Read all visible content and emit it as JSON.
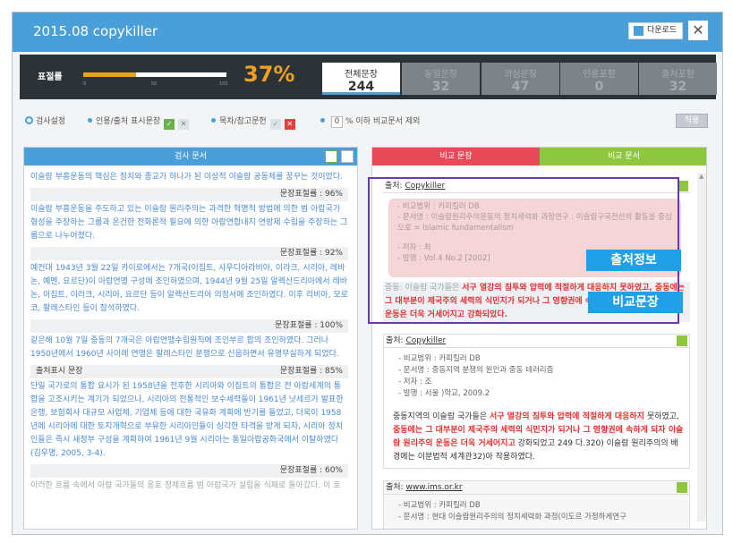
{
  "window": {
    "title": "2015.08 copykiller",
    "download_label": "다운로드",
    "close_symbol": "✕"
  },
  "stats": {
    "plagiarism_label": "표절률",
    "progress_fraction": 0.37,
    "ticks": [
      "0",
      "50",
      "100"
    ],
    "percent": "37%",
    "tabs": [
      {
        "label": "전체문장",
        "value": "244"
      },
      {
        "label": "동일문장",
        "value": "32"
      },
      {
        "label": "의심문장",
        "value": "47"
      },
      {
        "label": "인용포함",
        "value": "0"
      },
      {
        "label": "출처포함",
        "value": "32"
      }
    ]
  },
  "options": {
    "settings": "검사설정",
    "quote": "인용/출처 표시문장",
    "toc": "목차/참고문헌",
    "threshold": "0",
    "threshold_suffix": "% 이하 비교문서 제외",
    "apply": "적용"
  },
  "left": {
    "header": "검사 문서",
    "p1": "이슬람 부흥운동의 핵심은 정치와 종교가 하나가 된 이상적 이슬람 공동체를 꿈꾸는 것이었다.",
    "sim1": "문장표절률 : 96%",
    "p2": "이슬람 부흥운동을 주도하고 있는 이슬람 원리주의는 과격한 혁명적 방법에 의한 범 아랍국가 형성을 주장하는 그룹과 온건한 전화론적 필요에 의한 아랍연합내지 연방제 수립을 주장하는 그룹으로 나누어졌다.",
    "sim2": "문장표절률 : 92%",
    "p3": "예컨대 1943년 3월 22일 카이로에서는 7개국(이집트, 사우디아라비아, 이라크, 시리아, 레바논, 예멘, 요르단)이 아랍연맹 구성에 조인하였으며, 1944년 9월 25일 알렉산드리아에서 레바논, 이집트, 이라크, 시리아, 요르단 등이 알렉산드리아 의정서에 조인하였다. 이후 리비아, 모로코, 팔레스타인 등이 참석하였다.",
    "sim3": "문장표절률 : 100%",
    "p4": "같은해 10월 7일 중동의 7개국은 아랍연맹수립원칙에 조인부르 합의 조인하였다. 그러나 1950년에서 1960년 사이에 연맹은 팔레스타인 분쟁으로 신음하면서 유명무실하게 되었다.",
    "quote_label": "출처표시 문장",
    "sim4": "문장표절률 : 85%",
    "p5": "단일 국가로의 통합 요시가 된 1958년을 전후한 시리아와 이집트의 통합은 전 아랍세계의 통합을 고조시키는 계기가 되었으나, 시리아의 전통적인 보수세력들이 1961년 낫세르가 발표한 은행, 보험회사 대규모 사업체, 기업체 등에 대한 국유화 계획에 반기를 들었고, 더욱이 1958년에 시리아에 대한 토지개혁으로 부유한 시리아인들이 심각한 타격을 받게 되자, 시리아 정치인들은 즉시 새정부 구성을 계획하여 1961년 9월 시리아는 통일아랍공화국에서 이탈하였다(김우명, 2005, 3-4).",
    "sim5": "문장표절률 : 60%",
    "p6": "이러한 흐름 속에서 아랍 국가들의 옹호 정체흐름 범 아랍국가 설립을 식패로 돌아갔다. 이 호"
  },
  "right": {
    "tab1": "비교 문장",
    "tab2": "비교 문서",
    "c1": {
      "src_label": "출처:",
      "src": "Copykiller",
      "meta": [
        "- 비교범위 : 카피킬러 DB",
        "- 문서명 : 이슬람원리주의운동의 정치세력화 과정연구 : 이슬람구국전선의 활동을 중심으로 = Islamic fundamentalism",
        "- 저자 : 최",
        "- 발행 : Vol.4 No.2 [2002]"
      ],
      "text_a": "중동: 이슬람 국가들은 ",
      "text_red": "서구 열강의 침투와 압력에 적절하게 대응하지 못하였고, 중동에는 그 대부분이 제국주의 세력의 식민지가 되거나 그 영향권에 속하게 되자 이슬람 원리주의 운동은 더욱 거세어지고 강화되었다."
    },
    "c2": {
      "src_label": "출처:",
      "src": "Copykiller",
      "meta": [
        "- 비교범위 : 카피킬러 DB",
        "- 문서명 : 중동지역 분쟁의 원인과 중동 테러리즘",
        "- 저자 : 조",
        "- 발행 : 서울                    )학교, 2009.2"
      ],
      "text_a": "중동지역의 이슬람 국가들은 ",
      "text_red": "서구 열강의 침투와 압력에 적절하게 대응하지",
      "text_b": " 못하였고, ",
      "text_red2": "중동에는 그 대부분이 제국주의 세력의 식민지가 되거나 그 영향권에 속하게 되자 이슬람 원리주의 운동은 더욱 거세어지고",
      "text_c": " 강화되었고 249 다.320) 이슬람 원리주의의 배경에는 이분법적 세계관32)아 작용하였다."
    },
    "c3": {
      "src_label": "출처:",
      "src": "www.ims.or.kr",
      "meta": [
        "- 비교범위 : 카피킬러 DB",
        "- 문서명 : 현대 이슬람원리주의의 정치세력화 과정(이도르   가정하게연구"
      ]
    }
  },
  "badges": {
    "source_info": "출처정보",
    "compare_sentence": "비교문장"
  }
}
